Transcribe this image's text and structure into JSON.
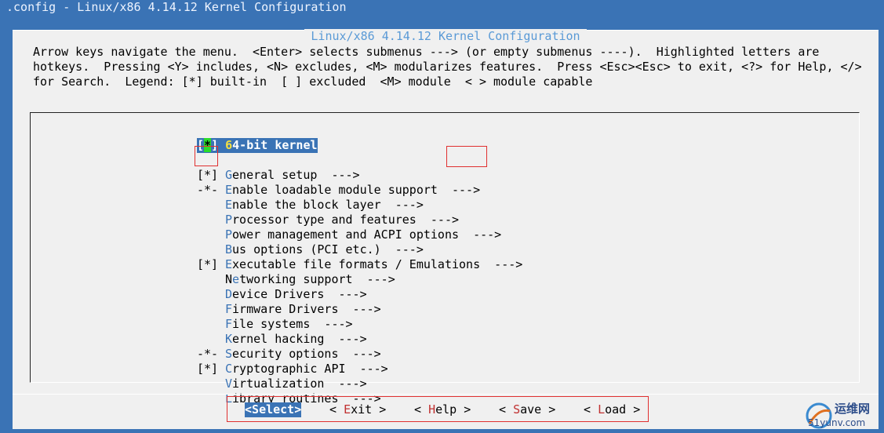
{
  "window": {
    "titlebar": ".config - Linux/x86 4.14.12 Kernel Configuration",
    "title": "Linux/x86 4.14.12 Kernel Configuration"
  },
  "help": {
    "lines": [
      "Arrow keys navigate the menu.  <Enter> selects submenus ---> (or empty submenus ----).  Highlighted letters are",
      "hotkeys.  Pressing <Y> includes, <N> excludes, <M> modularizes features.  Press <Esc><Esc> to exit, <?> for Help, </>",
      "for Search.  Legend: [*] built-in  [ ] excluded  <M> module  < > module capable"
    ]
  },
  "menu": {
    "items": [
      {
        "prefix": "[*]",
        "hot": "6",
        "rest": "4-bit kernel",
        "selected": true
      },
      {
        "prefix": "",
        "hot": "G",
        "rest": "eneral setup  --->"
      },
      {
        "prefix": "[*]",
        "hot": "E",
        "rest": "nable loadable module support  --->"
      },
      {
        "prefix": "-*-",
        "hot": "E",
        "rest": "nable the block layer  --->"
      },
      {
        "prefix": "",
        "hot": "P",
        "rest": "rocessor type and features  --->"
      },
      {
        "prefix": "",
        "hot": "P",
        "rest": "ower management and ACPI options  --->"
      },
      {
        "prefix": "",
        "hot": "B",
        "rest": "us options (PCI etc.)  --->"
      },
      {
        "prefix": "",
        "hot": "E",
        "rest": "xecutable file formats / Emulations  --->"
      },
      {
        "prefix": "[*]",
        "hot": "N",
        "rest": "etworking support  --->",
        "hot_index": 1
      },
      {
        "prefix": "",
        "hot": "D",
        "rest": "evice Drivers  --->"
      },
      {
        "prefix": "",
        "hot": "F",
        "rest": "irmware Drivers  --->"
      },
      {
        "prefix": "",
        "hot": "F",
        "rest": "ile systems  --->"
      },
      {
        "prefix": "",
        "hot": "K",
        "rest": "ernel hacking  --->"
      },
      {
        "prefix": "",
        "hot": "S",
        "rest": "ecurity options  --->"
      },
      {
        "prefix": "-*-",
        "hot": "C",
        "rest": "ryptographic API  --->"
      },
      {
        "prefix": "[*]",
        "hot": "V",
        "rest": "irtualization  --->"
      },
      {
        "prefix": "",
        "hot": "L",
        "rest": "ibrary routines  --->"
      }
    ]
  },
  "buttons": [
    {
      "open": "<",
      "hot": "S",
      "rest": "elect",
      "close": ">",
      "selected": true
    },
    {
      "open": "< ",
      "hot": "E",
      "rest": "xit",
      "close": " >"
    },
    {
      "open": "< ",
      "hot": "H",
      "rest": "elp",
      "close": " >"
    },
    {
      "open": "< ",
      "hot": "S",
      "rest": "ave",
      "close": " >"
    },
    {
      "open": "< ",
      "hot": "L",
      "rest": "oad",
      "close": " >"
    }
  ],
  "watermark": {
    "line1": "运维网",
    "line2": "51yunv.com"
  },
  "colors": {
    "background": "#3a73b5",
    "dialog": "#f0f0f0",
    "highlight": "#3a73b5",
    "hotkey_menu": "#3a73b5",
    "hotkey_button": "#c03030",
    "annotation": "#e03030"
  }
}
